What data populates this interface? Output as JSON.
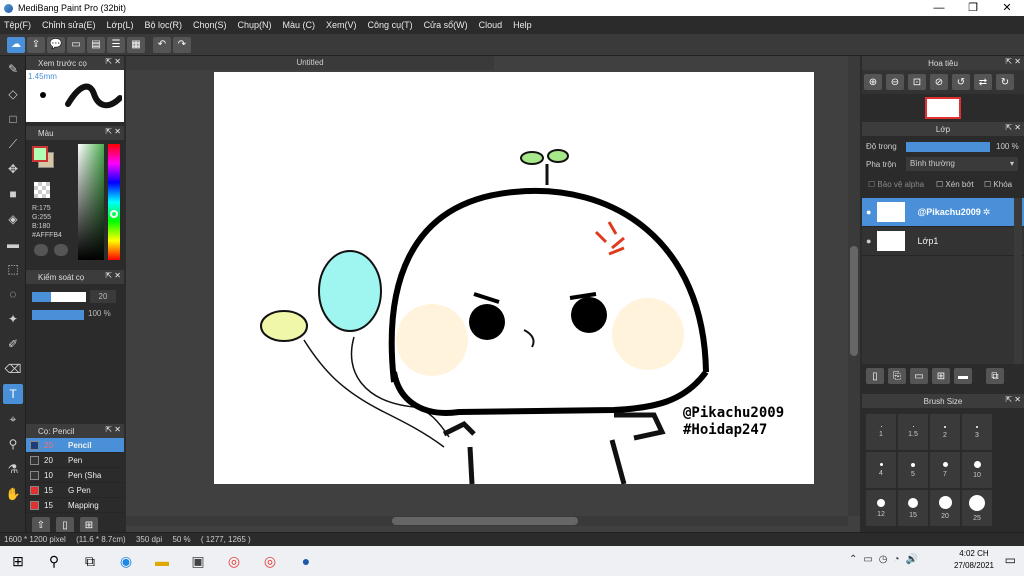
{
  "window": {
    "title": "MediBang Paint Pro (32bit)",
    "min": "—",
    "max": "❐",
    "close": "✕"
  },
  "menu": [
    "Tệp(F)",
    "Chỉnh sửa(E)",
    "Lớp(L)",
    "Bộ lọc(R)",
    "Chọn(S)",
    "Chụp(N)",
    "Màu (C)",
    "Xem(V)",
    "Công cụ(T)",
    "Cửa sổ(W)",
    "Cloud",
    "Help"
  ],
  "document_tab": "Untitled",
  "panels": {
    "brush_preview": {
      "title": "Xem trước cọ",
      "size": "1.45mm"
    },
    "color": {
      "title": "Màu",
      "r": "R:175",
      "g": "G:255",
      "b": "B:180",
      "hex": "#AFFFB4",
      "fg": "#afffb4",
      "bg": "#d7c6a2"
    },
    "brush_control": {
      "title": "Kiểm soát cọ",
      "size": "20",
      "opacity": "100 %"
    },
    "brush": {
      "title": "Cọ: Pencil",
      "items": [
        {
          "size": "20",
          "name": "Pencil",
          "color": "#1f3c7a",
          "selected": true
        },
        {
          "size": "20",
          "name": "Pen",
          "color": "#333333",
          "selected": false
        },
        {
          "size": "10",
          "name": "Pen (Sha",
          "color": "#333333",
          "selected": false
        },
        {
          "size": "15",
          "name": "G Pen",
          "color": "#e03030",
          "selected": false
        },
        {
          "size": "15",
          "name": "Mapping",
          "color": "#e03030",
          "selected": false
        }
      ]
    },
    "navigator": {
      "title": "Hoa tiêu"
    },
    "layer": {
      "title": "Lớp",
      "opacity_label": "Độ trong",
      "opacity": "100 %",
      "blend_label": "Pha trộn",
      "blend": "Bình thường",
      "protect_alpha": "Bảo vệ alpha",
      "clip": "Xén bớt",
      "lock": "Khóa",
      "layers": [
        {
          "name": "@Pikachu2009",
          "selected": true
        },
        {
          "name": "Lớp1",
          "selected": false
        }
      ]
    },
    "brush_size": {
      "title": "Brush Size",
      "sizes": [
        "1",
        "1.5",
        "2",
        "3",
        "4",
        "5",
        "7",
        "10",
        "12",
        "15",
        "20",
        "25"
      ]
    }
  },
  "canvas_text": {
    "line1": "@Pikachu2009",
    "line2": "#Hoidap247"
  },
  "status": {
    "size": "1600 * 1200 pixel",
    "dims": "(11.6 * 8.7cm)",
    "dpi": "350 dpi",
    "zoom": "50 %",
    "coords": "( 1277, 1265 )"
  },
  "taskbar": {
    "time": "4:02 CH",
    "date": "27/08/2021"
  }
}
